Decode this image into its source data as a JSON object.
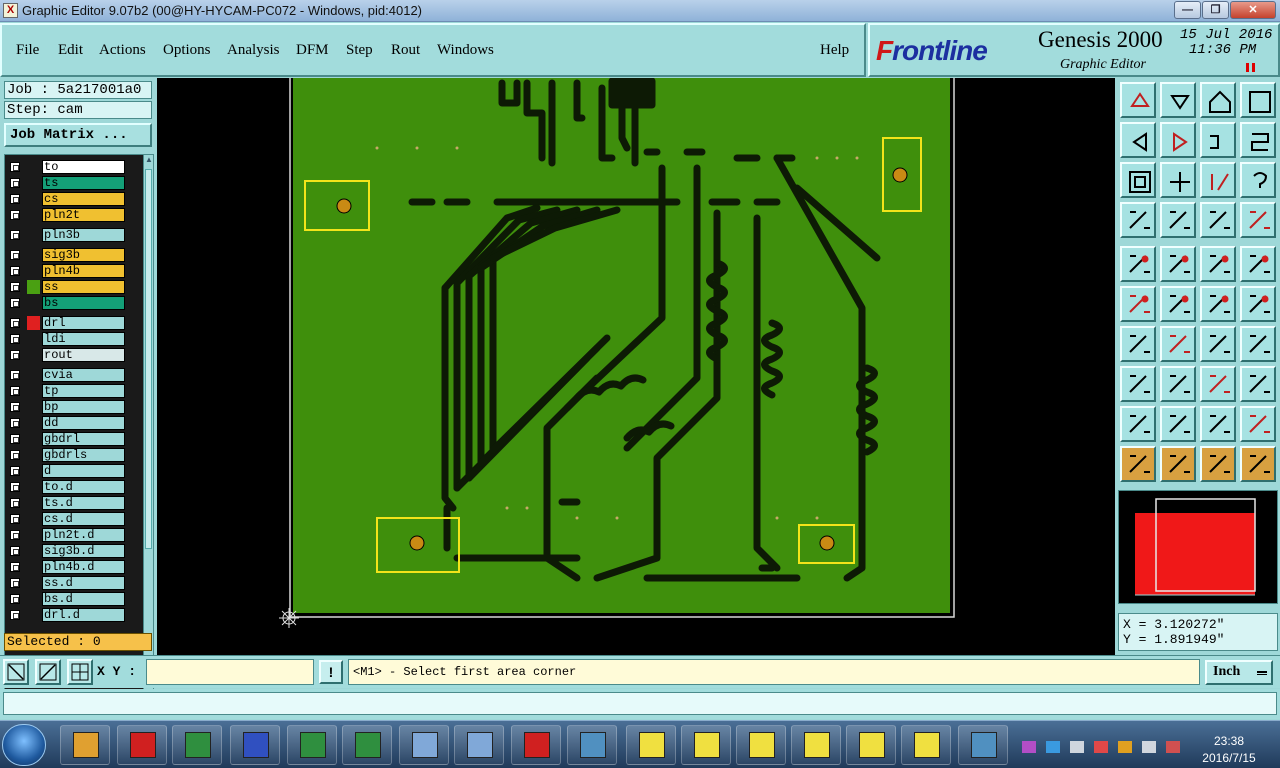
{
  "window": {
    "title": "Graphic Editor 9.07b2 (00@HY-HYCAM-PC072 - Windows, pid:4012)",
    "controls": [
      "—",
      "❐",
      "✕"
    ]
  },
  "menu": {
    "items": [
      "File",
      "Edit",
      "Actions",
      "Options",
      "Analysis",
      "DFM",
      "Step",
      "Rout",
      "Windows"
    ],
    "help": "Help"
  },
  "brand": {
    "logo_prefix": "F",
    "logo_rest": "rontline",
    "product": "Genesis 2000",
    "subtitle": "Graphic Editor",
    "date": "15 Jul 2016",
    "time": "11:36 PM"
  },
  "job": {
    "job_label": "Job : 5a217001a0",
    "step_label": "Step: cam",
    "matrix_button": "Job Matrix ..."
  },
  "layers": [
    {
      "name": "to",
      "color": "#ffffff",
      "swatch": "#1a1a1a"
    },
    {
      "name": "ts",
      "color": "#14a078",
      "swatch": "#1a1a1a"
    },
    {
      "name": "cs",
      "color": "#f0c030",
      "swatch": "#1a1a1a"
    },
    {
      "name": "pln2t",
      "color": "#f0c030",
      "swatch": "#1a1a1a"
    },
    {
      "name": "pln3b",
      "color": "#9ed8d8",
      "swatch": "#1a1a1a"
    },
    {
      "name": "sig3b",
      "color": "#f0c030",
      "swatch": "#1a1a1a"
    },
    {
      "name": "pln4b",
      "color": "#f0c030",
      "swatch": "#1a1a1a"
    },
    {
      "name": "ss",
      "color": "#f0c030",
      "swatch": "#4aa012"
    },
    {
      "name": "bs",
      "color": "#14a078",
      "swatch": "#1a1a1a"
    },
    {
      "name": "drl",
      "color": "#9ed8d8",
      "swatch": "#e02020"
    },
    {
      "name": "ldi",
      "color": "#9ed8d8",
      "swatch": "#1a1a1a"
    },
    {
      "name": "rout",
      "color": "#d8e8e8",
      "swatch": "#1a1a1a"
    },
    {
      "name": "cvia",
      "color": "#9ed8d8",
      "swatch": "#1a1a1a"
    },
    {
      "name": "tp",
      "color": "#9ed8d8",
      "swatch": "#1a1a1a"
    },
    {
      "name": "bp",
      "color": "#9ed8d8",
      "swatch": "#1a1a1a"
    },
    {
      "name": "dd",
      "color": "#9ed8d8",
      "swatch": "#1a1a1a"
    },
    {
      "name": "gbdrl",
      "color": "#9ed8d8",
      "swatch": "#1a1a1a"
    },
    {
      "name": "gbdrls",
      "color": "#9ed8d8",
      "swatch": "#1a1a1a"
    },
    {
      "name": "d",
      "color": "#9ed8d8",
      "swatch": "#1a1a1a"
    },
    {
      "name": "to.d",
      "color": "#9ed8d8",
      "swatch": "#1a1a1a"
    },
    {
      "name": "ts.d",
      "color": "#9ed8d8",
      "swatch": "#1a1a1a"
    },
    {
      "name": "cs.d",
      "color": "#9ed8d8",
      "swatch": "#1a1a1a"
    },
    {
      "name": "pln2t.d",
      "color": "#9ed8d8",
      "swatch": "#1a1a1a"
    },
    {
      "name": "sig3b.d",
      "color": "#9ed8d8",
      "swatch": "#1a1a1a"
    },
    {
      "name": "pln4b.d",
      "color": "#9ed8d8",
      "swatch": "#1a1a1a"
    },
    {
      "name": "ss.d",
      "color": "#9ed8d8",
      "swatch": "#1a1a1a"
    },
    {
      "name": "bs.d",
      "color": "#9ed8d8",
      "swatch": "#1a1a1a"
    },
    {
      "name": "drl.d",
      "color": "#9ed8d8",
      "swatch": "#1a1a1a"
    }
  ],
  "status": {
    "selected": "Selected : 0"
  },
  "canvas": {
    "board_color": "#3f8f0c",
    "trace_color": "#0d1a05",
    "pad_color": "#f2e41a",
    "hole_color": "#c98a14"
  },
  "tools": [
    "move-up",
    "move-down",
    "home",
    "zoom-window",
    "pan-left",
    "pan-right",
    "undo-zoom",
    "redraw",
    "fit-all",
    "zoom-center",
    "scale-1-2",
    "help",
    "measure",
    "grid",
    "display-net",
    "display-net-alt",
    "feature-snap",
    "color-layer",
    "ruler",
    "pad-snap",
    "connect-points",
    "center-snap",
    "endpoint-snap",
    "midpoint-snap",
    "angle-snap",
    "line-snap",
    "arc-snap",
    "mirror",
    "intersection-snap",
    "move-line",
    "dimension",
    "profile-snap",
    "draw-triangle",
    "draw-arrow-a",
    "draw-arrow-b",
    "draw-arrow-c",
    "select-pointer",
    "select-active",
    "select-rotate",
    "select-path"
  ],
  "coords": {
    "x": "X = 3.120272\"",
    "y": "Y = 1.891949\""
  },
  "command": {
    "xy_label": "X Y :",
    "xy_value": "",
    "excl": "!",
    "prompt": "<M1> - Select first area corner",
    "units": "Inch"
  },
  "taskbar": {
    "apps": [
      "shell",
      "g-red",
      "p-green",
      "save-disk",
      "excel-1",
      "excel-2",
      "image-1",
      "image-2",
      "pdf",
      "genesis-tray",
      "xwin-1",
      "xwin-2",
      "xwin-3",
      "xwin-4",
      "xwin-5",
      "xwin-6",
      "genesis-2"
    ],
    "time": "23:38",
    "date": "2016/7/15"
  }
}
